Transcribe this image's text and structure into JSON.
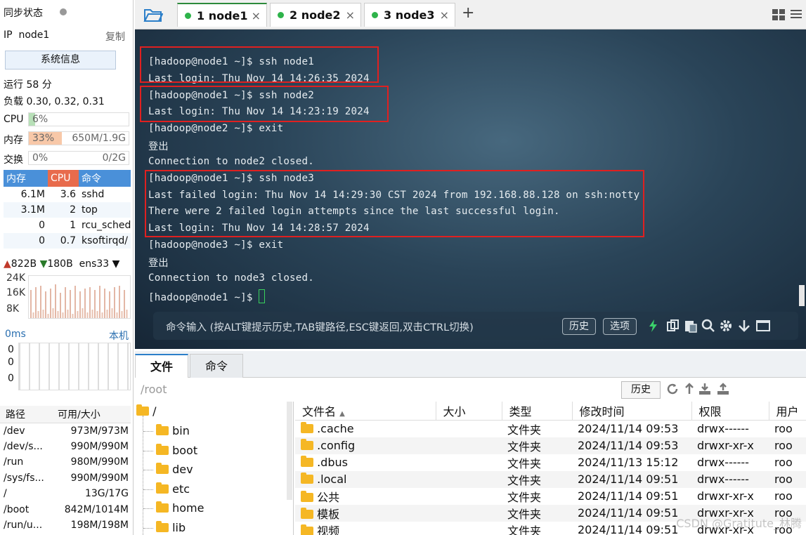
{
  "sidebar": {
    "sync_status": "同步状态",
    "ip_label": "IP",
    "ip_value": "node1",
    "copy_label": "复制",
    "sysinfo_button": "系统信息",
    "uptime": "运行 58 分",
    "load": "负载 0.30, 0.32, 0.31",
    "cpu": {
      "label": "CPU",
      "percent_text": "6%",
      "percent": 6
    },
    "mem": {
      "label": "内存",
      "percent_text": "33%",
      "detail": "650M/1.9G",
      "percent": 33
    },
    "swap": {
      "label": "交换",
      "percent_text": "0%",
      "detail": "0/2G",
      "percent": 0
    },
    "proc_headers": [
      "内存",
      "CPU",
      "命令"
    ],
    "procs": [
      {
        "mem": "6.1M",
        "cpu": "3.6",
        "cmd": "sshd"
      },
      {
        "mem": "3.1M",
        "cpu": "2",
        "cmd": "top"
      },
      {
        "mem": "0",
        "cpu": "1",
        "cmd": "rcu_sched"
      },
      {
        "mem": "0",
        "cpu": "0.7",
        "cmd": "ksoftirqd/"
      }
    ],
    "net_up": "822B",
    "net_down": "180B",
    "net_iface": "ens33",
    "net_axis": [
      "24K",
      "16K",
      "8K"
    ],
    "latency_label": "0ms",
    "latency_host": "本机",
    "latency_vals": [
      "0",
      "0",
      "0"
    ],
    "disk_headers": [
      "路径",
      "可用/大小"
    ],
    "disks": [
      {
        "path": "/dev",
        "size": "973M/973M"
      },
      {
        "path": "/dev/s...",
        "size": "990M/990M"
      },
      {
        "path": "/run",
        "size": "980M/990M"
      },
      {
        "path": "/sys/fs...",
        "size": "990M/990M"
      },
      {
        "path": "/",
        "size": "13G/17G"
      },
      {
        "path": "/boot",
        "size": "842M/1014M"
      },
      {
        "path": "/run/u...",
        "size": "198M/198M"
      }
    ]
  },
  "tabs": [
    {
      "label": "1 node1",
      "close": "×"
    },
    {
      "label": "2 node2",
      "close": "×"
    },
    {
      "label": "3 node3",
      "close": "×"
    }
  ],
  "add_tab": "+",
  "terminal": {
    "lines": [
      "[hadoop@node1 ~]$ ssh node1",
      "Last login: Thu Nov 14 14:26:35 2024",
      "[hadoop@node1 ~]$ ssh node2",
      "Last login: Thu Nov 14 14:23:19 2024",
      "[hadoop@node2 ~]$ exit",
      "登出",
      "Connection to node2 closed.",
      "[hadoop@node1 ~]$ ssh node3",
      "Last failed login: Thu Nov 14 14:29:30 CST 2024 from 192.168.88.128 on ssh:notty",
      "There were 2 failed login attempts since the last successful login.",
      "Last login: Thu Nov 14 14:28:57 2024",
      "[hadoop@node3 ~]$ exit",
      "登出",
      "Connection to node3 closed.",
      "[hadoop@node1 ~]$ "
    ],
    "cmd_placeholder": "命令输入 (按ALT键提示历史,TAB键路径,ESC键返回,双击CTRL切换)",
    "history_btn": "历史",
    "options_btn": "选项"
  },
  "bottom": {
    "tab_files": "文件",
    "tab_commands": "命令",
    "path": "/root",
    "history_btn": "历史",
    "tree_root": "/",
    "tree_items": [
      "bin",
      "boot",
      "dev",
      "etc",
      "home",
      "lib"
    ],
    "file_headers": [
      "文件名",
      "大小",
      "类型",
      "修改时间",
      "权限",
      "用户"
    ],
    "files": [
      {
        "name": ".cache",
        "size": "",
        "type": "文件夹",
        "mtime": "2024/11/14 09:53",
        "perm": "drwx------",
        "user": "roo"
      },
      {
        "name": ".config",
        "size": "",
        "type": "文件夹",
        "mtime": "2024/11/14 09:53",
        "perm": "drwxr-xr-x",
        "user": "roo"
      },
      {
        "name": ".dbus",
        "size": "",
        "type": "文件夹",
        "mtime": "2024/11/13 15:12",
        "perm": "drwx------",
        "user": "roo"
      },
      {
        "name": ".local",
        "size": "",
        "type": "文件夹",
        "mtime": "2024/11/14 09:51",
        "perm": "drwx------",
        "user": "roo"
      },
      {
        "name": "公共",
        "size": "",
        "type": "文件夹",
        "mtime": "2024/11/14 09:51",
        "perm": "drwxr-xr-x",
        "user": "roo"
      },
      {
        "name": "模板",
        "size": "",
        "type": "文件夹",
        "mtime": "2024/11/14 09:51",
        "perm": "drwxr-xr-x",
        "user": "roo"
      },
      {
        "name": "视频",
        "size": "",
        "type": "文件夹",
        "mtime": "2024/11/14 09:51",
        "perm": "drwxr-xr-x",
        "user": "roo"
      }
    ]
  },
  "watermark": "CSDN @Gratitute_林腾",
  "colors": {
    "accent": "#2c8a3b",
    "terminal_bg": "#2a4458",
    "highlight_box": "#e02020",
    "cpu_fill": "#b8e0b8",
    "mem_fill": "#f8c8a8"
  }
}
